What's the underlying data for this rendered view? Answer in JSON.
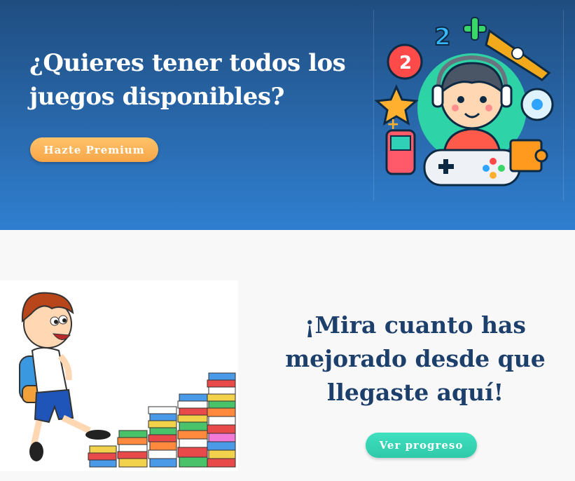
{
  "hero": {
    "title": "¿Quieres tener todos los juegos disponibles?",
    "premium_label": "Hazte Premium",
    "decor_numbers": [
      "2",
      "2"
    ],
    "decor_symbol": "+"
  },
  "progress": {
    "title": "¡Mira cuanto has mejorado desde que llegaste aquí!",
    "button_label": "Ver progreso"
  },
  "colors": {
    "hero_top": "#1f4d80",
    "hero_bottom": "#2f7fd0",
    "premium_button": "#f7a548",
    "progress_button": "#2fc9a8",
    "progress_title": "#1d3f6b"
  }
}
